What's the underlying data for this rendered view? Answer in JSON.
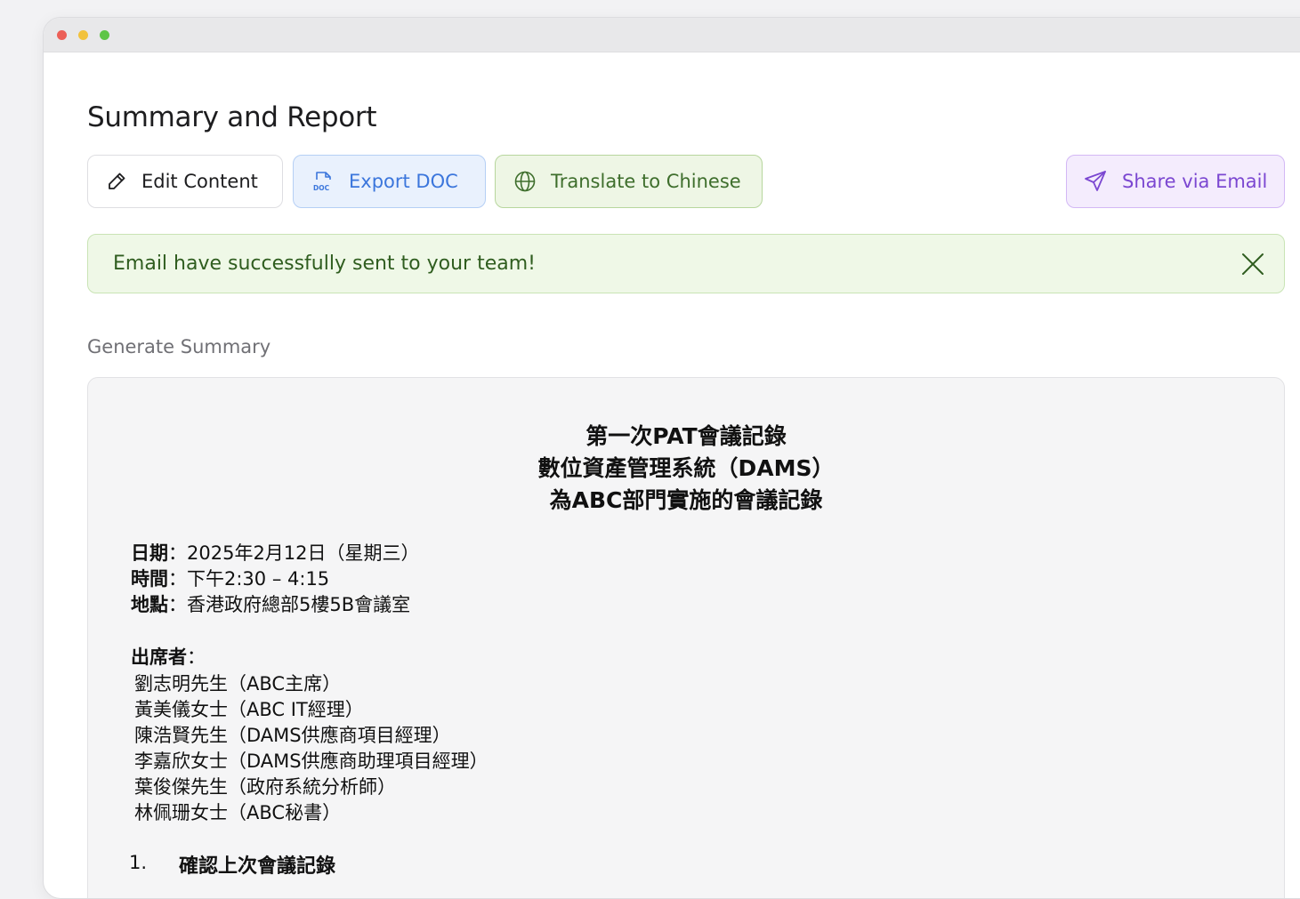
{
  "page": {
    "title": "Summary and Report",
    "section_label": "Generate Summary"
  },
  "toolbar": {
    "edit_label": "Edit Content",
    "export_label": "Export DOC",
    "translate_label": "Translate to Chinese",
    "share_label": "Share via Email"
  },
  "alert": {
    "message": "Email have successfully sent to your team!"
  },
  "document": {
    "title_lines": [
      "第一次PAT會議記錄",
      "數位資產管理系統（DAMS）",
      "為ABC部門實施的會議記錄"
    ],
    "meta": [
      {
        "label": "日期",
        "value": "：2025年2月12日（星期三）"
      },
      {
        "label": "時間",
        "value": "：下午2:30 – 4:15"
      },
      {
        "label": "地點",
        "value": "：香港政府總部5樓5B會議室"
      }
    ],
    "attendees_label": "出席者",
    "attendees_colon": "：",
    "attendees": [
      "劉志明先生（ABC主席）",
      "黃美儀女士（ABC IT經理）",
      "陳浩賢先生（DAMS供應商項目經理）",
      "李嘉欣女士（DAMS供應商助理項目經理）",
      "葉俊傑先生（政府系統分析師）",
      "林佩珊女士（ABC秘書）"
    ],
    "items": [
      {
        "number": "1.",
        "heading": "確認上次會議記錄"
      }
    ]
  },
  "colors": {
    "export_accent": "#3b76dc",
    "translate_accent": "#3e6e2c",
    "share_accent": "#7b47d1",
    "success_bg": "#eff8e7"
  },
  "icons": {
    "edit": "pencil-icon",
    "export": "doc-file-icon",
    "translate": "globe-icon",
    "share": "send-icon",
    "close": "close-icon"
  }
}
